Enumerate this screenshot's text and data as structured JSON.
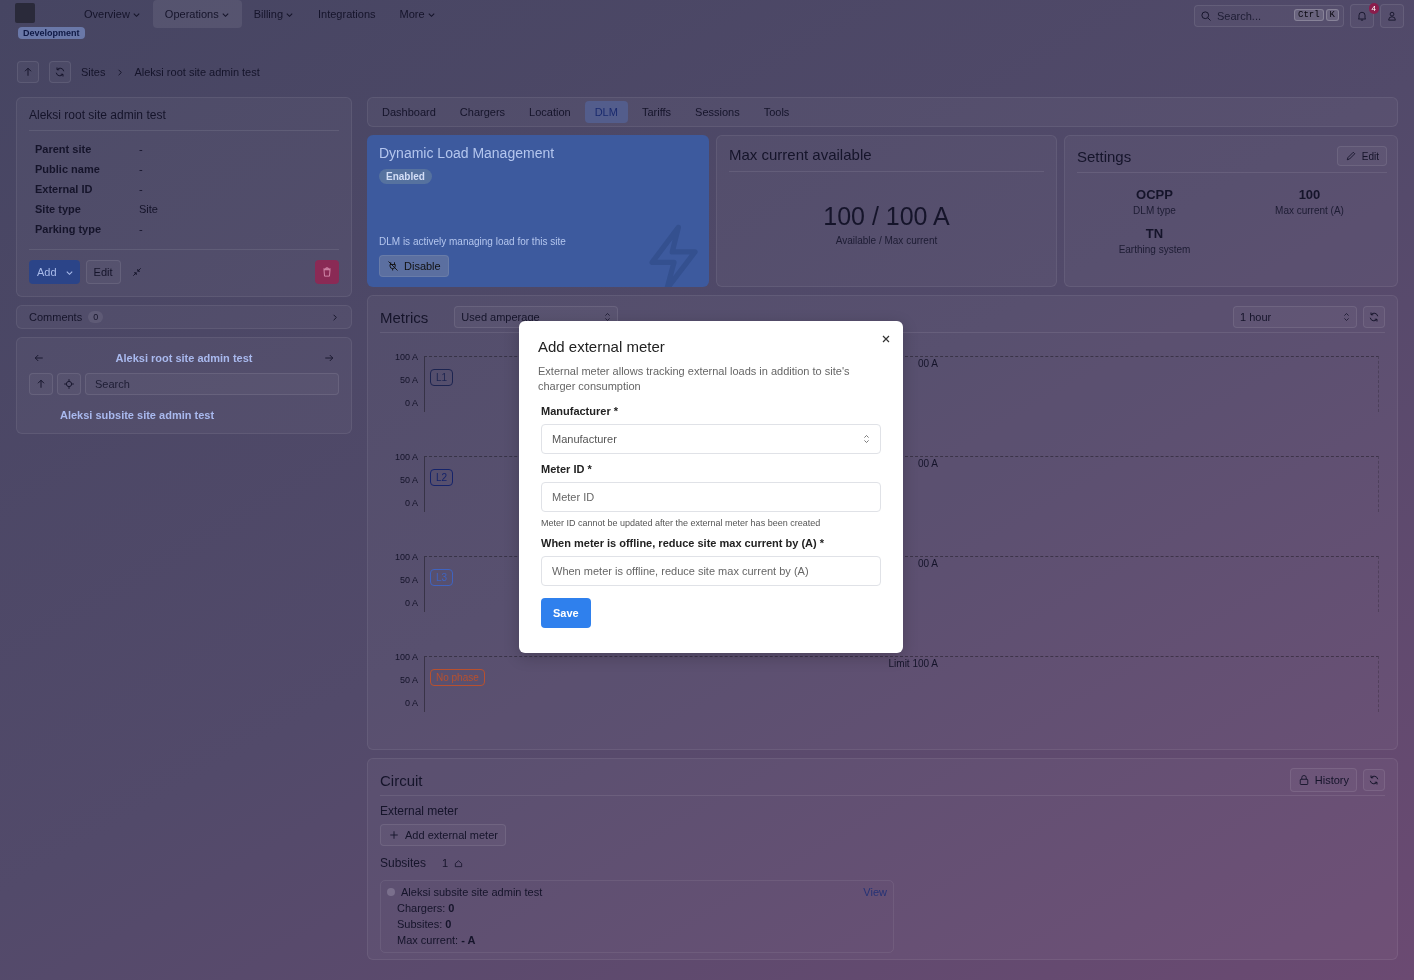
{
  "nav": {
    "items": [
      {
        "label": "Overview",
        "dropdown": true,
        "selected": false
      },
      {
        "label": "Operations",
        "dropdown": true,
        "selected": true
      },
      {
        "label": "Billing",
        "dropdown": true,
        "selected": false
      },
      {
        "label": "Integrations",
        "dropdown": false,
        "selected": false
      },
      {
        "label": "More",
        "dropdown": true,
        "selected": false
      }
    ],
    "environment": "Development",
    "search": {
      "placeholder": "Search...",
      "keys": [
        "Ctrl",
        "K"
      ]
    },
    "notifications": "4"
  },
  "breadcrumb": [
    "Sites",
    "Aleksi root site admin test"
  ],
  "site": {
    "title": "Aleksi root site admin test",
    "fields": [
      {
        "label": "Parent site",
        "value": "-"
      },
      {
        "label": "Public name",
        "value": "-"
      },
      {
        "label": "External ID",
        "value": "-"
      },
      {
        "label": "Site type",
        "value": "Site"
      },
      {
        "label": "Parking type",
        "value": "-"
      }
    ],
    "add": "Add",
    "edit": "Edit"
  },
  "comments": {
    "label": "Comments",
    "count": "0"
  },
  "tree": {
    "title": "Aleksi root site admin test",
    "search_placeholder": "Search",
    "children": [
      {
        "label": "Aleksi subsite site admin test"
      }
    ]
  },
  "tabs": [
    {
      "label": "Dashboard",
      "selected": false
    },
    {
      "label": "Chargers",
      "selected": false
    },
    {
      "label": "Location",
      "selected": false
    },
    {
      "label": "DLM",
      "selected": true
    },
    {
      "label": "Tariffs",
      "selected": false
    },
    {
      "label": "Sessions",
      "selected": false
    },
    {
      "label": "Tools",
      "selected": false
    }
  ],
  "dlm": {
    "title": "Dynamic Load Management",
    "status": "Enabled",
    "message": "DLM is actively managing load for this site",
    "action": "Disable"
  },
  "max_current": {
    "title": "Max current available",
    "value": "100 / 100 A",
    "caption": "Available / Max current"
  },
  "settings": {
    "title": "Settings",
    "edit": "Edit",
    "items": [
      {
        "value": "OCPP",
        "label": "DLM type"
      },
      {
        "value": "100",
        "label": "Max current (A)"
      },
      {
        "value": "TN",
        "label": "Earthing system"
      }
    ]
  },
  "metrics": {
    "title": "Metrics",
    "metric": "Used amperage",
    "range": "1 hour",
    "panels": [
      {
        "phase": "L1",
        "color": "#1c2450",
        "yticks": [
          "100 A",
          "50 A",
          "0 A"
        ],
        "limit_label": "00 A"
      },
      {
        "phase": "L2",
        "color": "#15236a",
        "yticks": [
          "100 A",
          "50 A",
          "0 A"
        ],
        "limit_label": "00 A"
      },
      {
        "phase": "L3",
        "color": "#3f63c0",
        "yticks": [
          "100 A",
          "50 A",
          "0 A"
        ],
        "limit_label": "00 A"
      },
      {
        "phase": "No phase",
        "color": "#b8502e",
        "yticks": [
          "100 A",
          "50 A",
          "0 A"
        ],
        "limit_label": "Limit 100 A"
      }
    ]
  },
  "circuit": {
    "title": "Circuit",
    "history": "History",
    "external_meter_label": "External meter",
    "add_meter": "Add external meter",
    "subsites_label": "Subsites",
    "subsites_count": "1",
    "subsites": [
      {
        "name": "Aleksi subsite site admin test",
        "action": "View",
        "details": [
          "Chargers: **0**",
          "Subsites: **0**",
          "Max current: **- A**"
        ]
      }
    ]
  },
  "modal": {
    "title": "Add external meter",
    "description": "External meter allows tracking external loads in addition to site's charger consumption",
    "fields": [
      {
        "kind": "select",
        "label": "Manufacturer *",
        "placeholder": "Manufacturer"
      },
      {
        "kind": "text",
        "label": "Meter ID *",
        "placeholder": "Meter ID",
        "hint": "Meter ID cannot be updated after the external meter has been created"
      },
      {
        "kind": "text",
        "label": "When meter is offline, reduce site max current by (A) *",
        "placeholder": "When meter is offline, reduce site max current by (A)"
      }
    ],
    "submit": "Save"
  }
}
